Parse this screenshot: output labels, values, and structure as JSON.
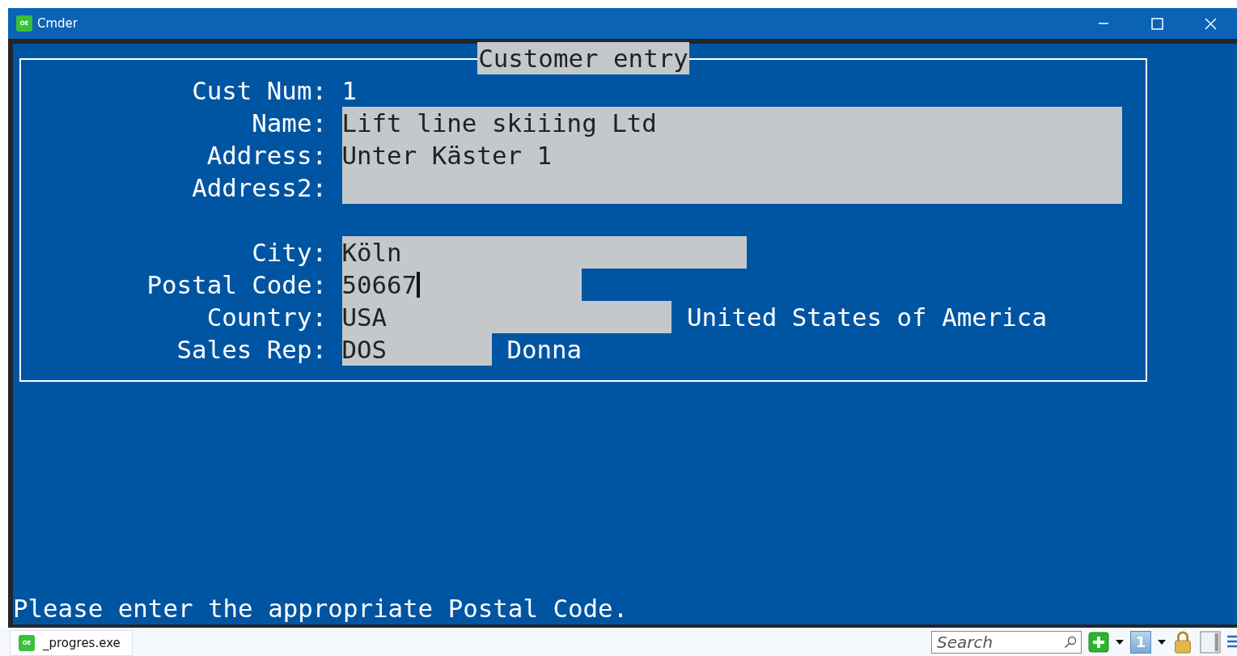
{
  "window": {
    "title": "Cmder",
    "icon_text": "OE"
  },
  "form": {
    "title": "Customer entry",
    "fields": [
      {
        "label": "Cust Num:",
        "kind": "display",
        "value": "1"
      },
      {
        "label": "Name:",
        "kind": "fill-in",
        "value": "Lift line skiiing Ltd",
        "focused": false
      },
      {
        "label": "Address:",
        "kind": "fill-in",
        "value": "Unter Käster 1",
        "focused": false
      },
      {
        "label": "Address2:",
        "kind": "fill-in",
        "focused": false
      },
      {
        "kind": "blank"
      },
      {
        "label": "City:",
        "kind": "fill-in",
        "value": "Köln",
        "focused": false
      },
      {
        "label": "Postal Code:",
        "kind": "fill-in",
        "value": "50667",
        "focused": true
      },
      {
        "label": "Country:",
        "kind": "fill-in",
        "value": "USA",
        "focused": false,
        "side_text": "United States of America"
      },
      {
        "label": "Sales Rep:",
        "kind": "fill-in",
        "value": "DOS",
        "focused": false,
        "side_text": "Donna"
      }
    ]
  },
  "message": "Please enter the appropriate Postal Code.",
  "taskbar": {
    "tab": {
      "icon_text": "OE",
      "label": "_progres.exe"
    },
    "search": {
      "placeholder": "Search"
    },
    "number_button": "1"
  }
}
